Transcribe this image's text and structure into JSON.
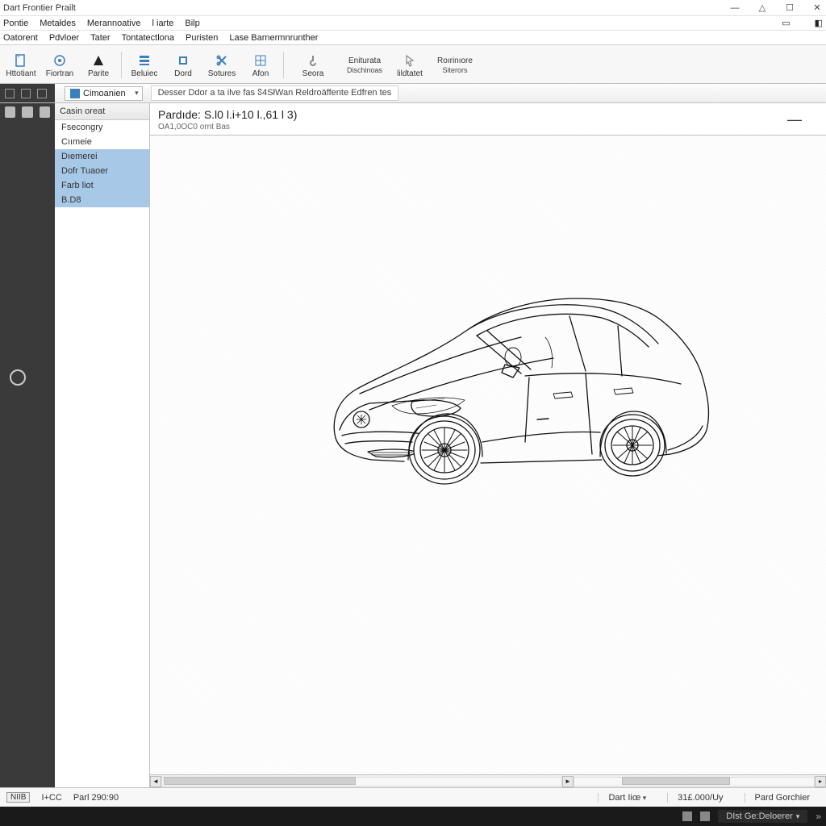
{
  "title": "Dart Frontier Prailt",
  "menus": {
    "row1": [
      "Pontie",
      "Metałdes",
      "Merannoative",
      "l iarte",
      "Bilp"
    ],
    "row2": [
      "Oatorent",
      "Pdvloer",
      "Tater",
      "Tontatectlona",
      "Puristen",
      "Lase Barnermnrunther"
    ]
  },
  "toolbar": [
    {
      "icon": "page-icon",
      "label": "Httotiant"
    },
    {
      "icon": "target-icon",
      "label": "Fiortran"
    },
    {
      "icon": "triangle-icon",
      "label": "Parite"
    },
    {
      "icon": "list-icon",
      "label": "Beluiec"
    },
    {
      "icon": "box-icon",
      "label": "Dord"
    },
    {
      "icon": "layers-icon",
      "label": "Sotures"
    },
    {
      "icon": "ruler-icon",
      "label": "Afon"
    },
    {
      "icon": "hook-icon",
      "label": "Seora",
      "label2": "Eniturata",
      "label3": "Dischinoas"
    },
    {
      "icon": "cursor-icon",
      "label": "lildtatet"
    },
    {
      "icon": "",
      "label": "Roırinıore",
      "label2": "Siterors"
    }
  ],
  "companion": {
    "label": "Cimoanien",
    "desc": "Desser Ddor a ta ilve fas ჽ4SłWan Reldroäffente Edfren tes"
  },
  "sidebar": {
    "header": "Casin oreat",
    "items": [
      {
        "label": "Fsecongry",
        "sel": false
      },
      {
        "label": "Cıımeie",
        "sel": false
      },
      {
        "label": "Dıemerei",
        "sel": true
      },
      {
        "label": "Dofr Tuaoer",
        "sel": true
      },
      {
        "label": "Farb liot",
        "sel": true
      },
      {
        "label": "B.D8",
        "sel": true
      }
    ]
  },
  "main": {
    "title": "Pardıde: S.l0 l.i+10 l.,61 l 3)",
    "subtitle": "OA1,0OC0 ornt Bas"
  },
  "status": {
    "chip": "NIIB",
    "hcc": "I+CC",
    "parl": "Parl 290:90",
    "dart": "Dart Iiœ",
    "val": "31£.000/Uy",
    "pard": "Pard Gorchier"
  },
  "taskbar": {
    "label": "DIst Ge:Deloerer"
  }
}
